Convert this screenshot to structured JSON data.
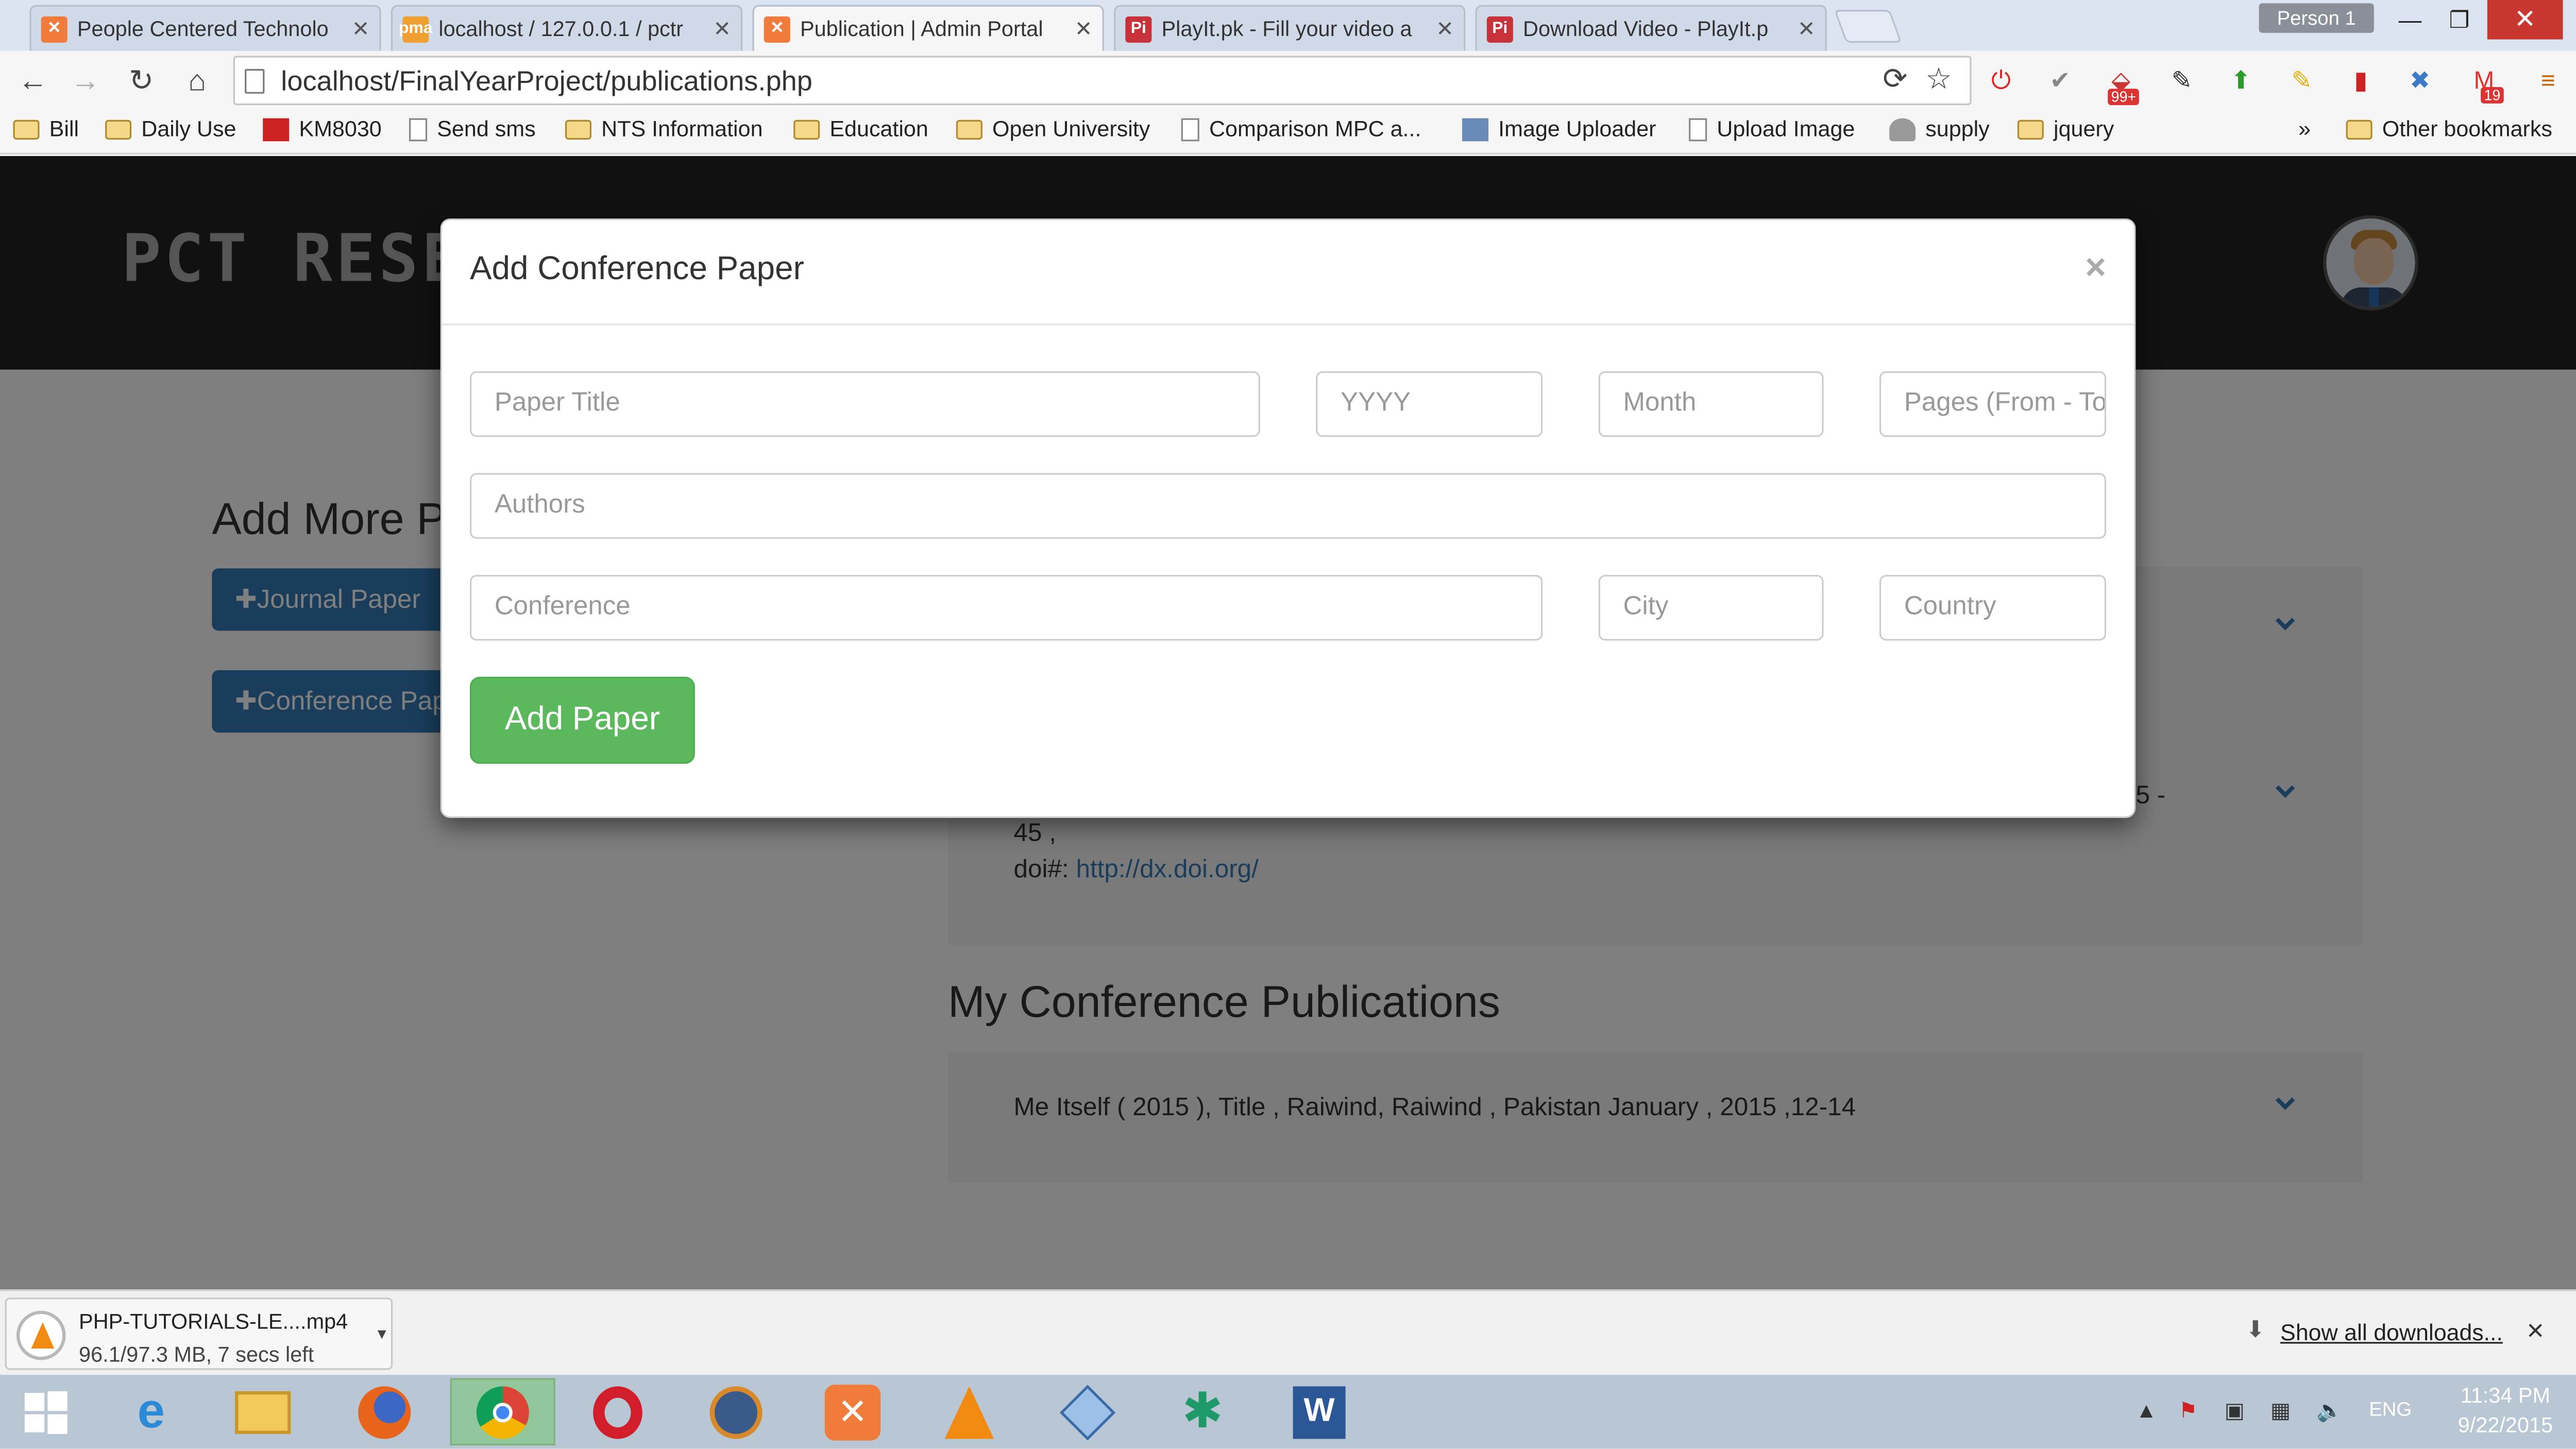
{
  "browser": {
    "tabs": [
      {
        "label": "People Centered Technolo",
        "favicon_color": "#f07b3a",
        "active": false
      },
      {
        "label": "localhost / 127.0.0.1 / pctr",
        "favicon_color": "#f0a030",
        "active": false
      },
      {
        "label": "Publication | Admin Portal",
        "favicon_color": "#f07b3a",
        "active": true
      },
      {
        "label": "PlayIt.pk - Fill your video a",
        "favicon_color": "#c8323a",
        "active": false
      },
      {
        "label": "Download Video - PlayIt.p",
        "favicon_color": "#c8323a",
        "active": false
      }
    ],
    "person_label": "Person 1",
    "url": "localhost/FinalYearProject/publications.php",
    "bookmarks": [
      {
        "label": "Bill",
        "type": "folder"
      },
      {
        "label": "Daily Use",
        "type": "folder"
      },
      {
        "label": "KM8030",
        "type": "site"
      },
      {
        "label": "Send sms",
        "type": "doc"
      },
      {
        "label": "NTS Information",
        "type": "folder"
      },
      {
        "label": "Education",
        "type": "folder"
      },
      {
        "label": "Open University",
        "type": "folder"
      },
      {
        "label": "Comparison MPC a...",
        "type": "doc"
      },
      {
        "label": "Image Uploader",
        "type": "site"
      },
      {
        "label": "Upload Image",
        "type": "doc"
      },
      {
        "label": "supply",
        "type": "site"
      },
      {
        "label": "jquery",
        "type": "folder"
      }
    ],
    "bookmarks_more": "»",
    "other_bookmarks": "Other bookmarks",
    "badges": {
      "ext_count": "99+",
      "gmail_count": "19"
    }
  },
  "page": {
    "brand": "PCT RESEARCH",
    "side_title": "Add More Publications",
    "journal_button": "✚Journal Paper",
    "conference_button": "✚Conference Paper",
    "journal_pub": {
      "line_tail": "5 -",
      "line2": "45 ,",
      "doi_label": "doi#:",
      "doi_link": "http://dx.doi.org/"
    },
    "conference_section_title": "My Conference Publications",
    "conference_pub": "Me Itself ( 2015 ), Title , Raiwind, Raiwind , Pakistan January , 2015 ,12-14"
  },
  "modal": {
    "title": "Add Conference Paper",
    "close": "×",
    "fields": {
      "paper_title": "Paper Title",
      "year": "YYYY",
      "month": "Month",
      "pages": "Pages (From - To)",
      "authors": "Authors",
      "conference": "Conference",
      "city": "City",
      "country": "Country"
    },
    "submit": "Add Paper"
  },
  "downloads": {
    "file_name": "PHP-TUTORIALS-LE....mp4",
    "status": "96.1/97.3 MB, 7 secs left",
    "show_all": "Show all downloads...",
    "close": "×"
  },
  "taskbar": {
    "apps": [
      "windows-start",
      "internet-explorer",
      "file-explorer",
      "firefox",
      "chrome",
      "opera",
      "media-player",
      "xampp",
      "vlc",
      "virtualbox",
      "app-green",
      "word"
    ],
    "lang": "ENG",
    "time": "11:34 PM",
    "date": "9/22/2015"
  },
  "colors": {
    "primary": "#337ab7",
    "success": "#5cb85c",
    "header_bg": "#222222"
  }
}
